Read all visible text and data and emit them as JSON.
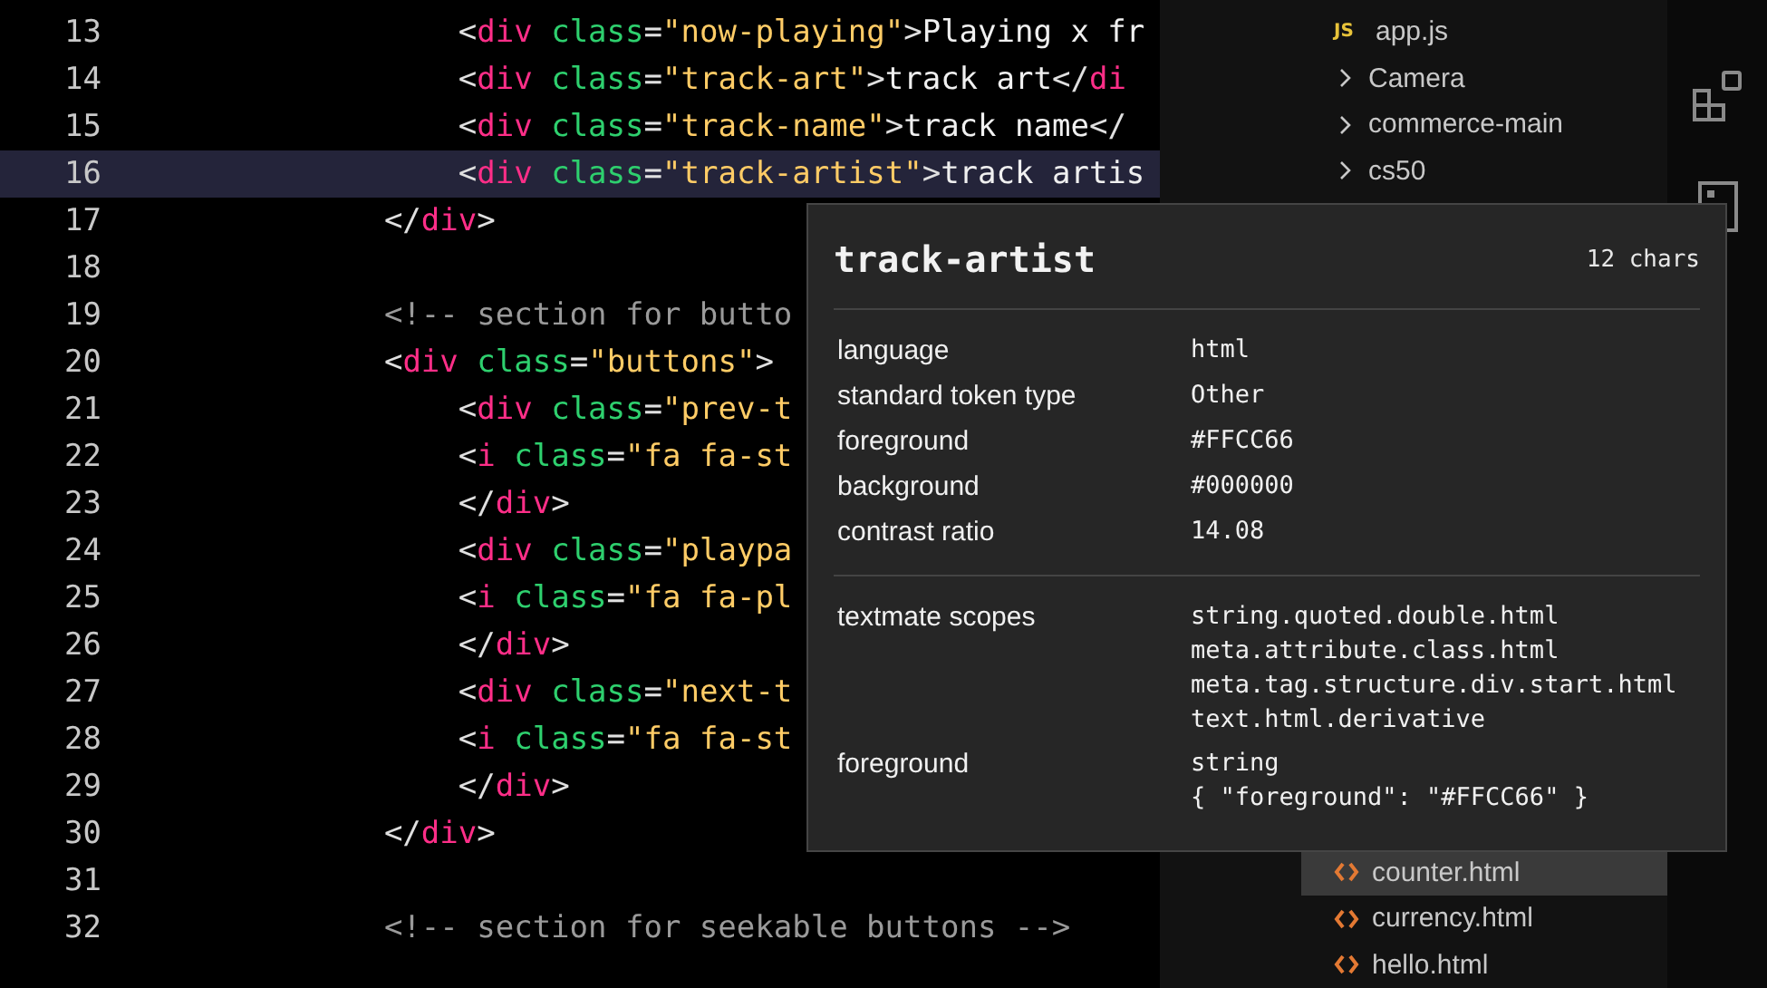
{
  "editor": {
    "lines": [
      {
        "number": "13",
        "current": false,
        "tokens": [
          {
            "kind": "punct",
            "text": "        <"
          },
          {
            "kind": "tag",
            "text": "div"
          },
          {
            "kind": "attr",
            "text": " class"
          },
          {
            "kind": "punct",
            "text": "="
          },
          {
            "kind": "string",
            "text": "\"now-playing\""
          },
          {
            "kind": "punct",
            "text": ">"
          },
          {
            "kind": "text",
            "text": "Playing x fr"
          }
        ]
      },
      {
        "number": "14",
        "current": false,
        "tokens": [
          {
            "kind": "punct",
            "text": "        <"
          },
          {
            "kind": "tag",
            "text": "div"
          },
          {
            "kind": "attr",
            "text": " class"
          },
          {
            "kind": "punct",
            "text": "="
          },
          {
            "kind": "string",
            "text": "\"track-art\""
          },
          {
            "kind": "punct",
            "text": ">"
          },
          {
            "kind": "text",
            "text": "track art"
          },
          {
            "kind": "punct",
            "text": "</"
          },
          {
            "kind": "tag",
            "text": "di"
          }
        ]
      },
      {
        "number": "15",
        "current": false,
        "tokens": [
          {
            "kind": "punct",
            "text": "        <"
          },
          {
            "kind": "tag",
            "text": "div"
          },
          {
            "kind": "attr",
            "text": " class"
          },
          {
            "kind": "punct",
            "text": "="
          },
          {
            "kind": "string",
            "text": "\"track-name\""
          },
          {
            "kind": "punct",
            "text": ">"
          },
          {
            "kind": "text",
            "text": "track name"
          },
          {
            "kind": "punct",
            "text": "</"
          }
        ]
      },
      {
        "number": "16",
        "current": true,
        "tokens": [
          {
            "kind": "punct",
            "text": "        <"
          },
          {
            "kind": "tag",
            "text": "div"
          },
          {
            "kind": "attr",
            "text": " class"
          },
          {
            "kind": "punct",
            "text": "="
          },
          {
            "kind": "string",
            "text": "\"track-artist\""
          },
          {
            "kind": "punct",
            "text": ">"
          },
          {
            "kind": "text",
            "text": "track artis"
          }
        ]
      },
      {
        "number": "17",
        "current": false,
        "tokens": [
          {
            "kind": "punct",
            "text": "    </"
          },
          {
            "kind": "tag",
            "text": "div"
          },
          {
            "kind": "punct",
            "text": ">"
          }
        ]
      },
      {
        "number": "18",
        "current": false
      },
      {
        "number": "19",
        "current": false,
        "tokens": [
          {
            "kind": "comment",
            "text": "    <!-- section for butto"
          }
        ]
      },
      {
        "number": "20",
        "current": false,
        "tokens": [
          {
            "kind": "punct",
            "text": "    <"
          },
          {
            "kind": "tag",
            "text": "div"
          },
          {
            "kind": "attr",
            "text": " class"
          },
          {
            "kind": "punct",
            "text": "="
          },
          {
            "kind": "string",
            "text": "\"buttons\""
          },
          {
            "kind": "punct",
            "text": ">"
          }
        ]
      },
      {
        "number": "21",
        "current": false,
        "tokens": [
          {
            "kind": "punct",
            "text": "        <"
          },
          {
            "kind": "tag",
            "text": "div"
          },
          {
            "kind": "attr",
            "text": " class"
          },
          {
            "kind": "punct",
            "text": "="
          },
          {
            "kind": "string",
            "text": "\"prev-t"
          }
        ]
      },
      {
        "number": "22",
        "current": false,
        "tokens": [
          {
            "kind": "punct",
            "text": "        <"
          },
          {
            "kind": "tag",
            "text": "i"
          },
          {
            "kind": "attr",
            "text": " class"
          },
          {
            "kind": "punct",
            "text": "="
          },
          {
            "kind": "string",
            "text": "\"fa fa-st"
          }
        ]
      },
      {
        "number": "23",
        "current": false,
        "tokens": [
          {
            "kind": "punct",
            "text": "        </"
          },
          {
            "kind": "tag",
            "text": "div"
          },
          {
            "kind": "punct",
            "text": ">"
          }
        ]
      },
      {
        "number": "24",
        "current": false,
        "tokens": [
          {
            "kind": "punct",
            "text": "        <"
          },
          {
            "kind": "tag",
            "text": "div"
          },
          {
            "kind": "attr",
            "text": " class"
          },
          {
            "kind": "punct",
            "text": "="
          },
          {
            "kind": "string",
            "text": "\"playpa"
          }
        ]
      },
      {
        "number": "25",
        "current": false,
        "tokens": [
          {
            "kind": "punct",
            "text": "        <"
          },
          {
            "kind": "tag",
            "text": "i"
          },
          {
            "kind": "attr",
            "text": " class"
          },
          {
            "kind": "punct",
            "text": "="
          },
          {
            "kind": "string",
            "text": "\"fa fa-pl"
          }
        ]
      },
      {
        "number": "26",
        "current": false,
        "tokens": [
          {
            "kind": "punct",
            "text": "        </"
          },
          {
            "kind": "tag",
            "text": "div"
          },
          {
            "kind": "punct",
            "text": ">"
          }
        ]
      },
      {
        "number": "27",
        "current": false,
        "tokens": [
          {
            "kind": "punct",
            "text": "        <"
          },
          {
            "kind": "tag",
            "text": "div"
          },
          {
            "kind": "attr",
            "text": " class"
          },
          {
            "kind": "punct",
            "text": "="
          },
          {
            "kind": "string",
            "text": "\"next-t"
          }
        ]
      },
      {
        "number": "28",
        "current": false,
        "tokens": [
          {
            "kind": "punct",
            "text": "        <"
          },
          {
            "kind": "tag",
            "text": "i"
          },
          {
            "kind": "attr",
            "text": " class"
          },
          {
            "kind": "punct",
            "text": "="
          },
          {
            "kind": "string",
            "text": "\"fa fa-st"
          }
        ]
      },
      {
        "number": "29",
        "current": false,
        "tokens": [
          {
            "kind": "punct",
            "text": "        </"
          },
          {
            "kind": "tag",
            "text": "div"
          },
          {
            "kind": "punct",
            "text": ">"
          }
        ]
      },
      {
        "number": "30",
        "current": false,
        "tokens": [
          {
            "kind": "punct",
            "text": "    </"
          },
          {
            "kind": "tag",
            "text": "div"
          },
          {
            "kind": "punct",
            "text": ">"
          }
        ]
      },
      {
        "number": "31",
        "current": false
      },
      {
        "number": "32",
        "current": false,
        "tokens": [
          {
            "kind": "comment",
            "text": "    <!-- section for seekable buttons -->"
          }
        ]
      }
    ]
  },
  "explorer": {
    "top": [
      {
        "kind": "file",
        "badge": "JS",
        "label": "app.js",
        "selected": false
      },
      {
        "kind": "folder",
        "label": "Camera",
        "expanded": false,
        "selected": false
      },
      {
        "kind": "folder",
        "label": "commerce-main",
        "expanded": false,
        "selected": false
      },
      {
        "kind": "folder",
        "label": "cs50",
        "expanded": false,
        "selected": false
      }
    ],
    "bottom": [
      {
        "kind": "html",
        "label": "counter.html",
        "selected": true
      },
      {
        "kind": "html",
        "label": "currency.html",
        "selected": false
      },
      {
        "kind": "html",
        "label": "hello.html",
        "selected": false
      }
    ]
  },
  "hover": {
    "title": "track-artist",
    "count": "12 chars",
    "sections": [
      {
        "rows": [
          {
            "label": "language",
            "values": [
              "html"
            ]
          },
          {
            "label": "standard token type",
            "values": [
              "Other"
            ]
          },
          {
            "label": "foreground",
            "values": [
              "#FFCC66"
            ]
          },
          {
            "label": "background",
            "values": [
              "#000000"
            ]
          },
          {
            "label": "contrast ratio",
            "values": [
              "14.08"
            ]
          }
        ]
      },
      {
        "rows": [
          {
            "label": "textmate scopes",
            "values": [
              "string.quoted.double.html",
              "meta.attribute.class.html",
              "meta.tag.structure.div.start.html",
              "text.html.derivative"
            ]
          },
          {
            "label": "foreground",
            "values": [
              "string",
              "{ \"foreground\": \"#FFCC66\" }"
            ]
          }
        ]
      }
    ]
  }
}
